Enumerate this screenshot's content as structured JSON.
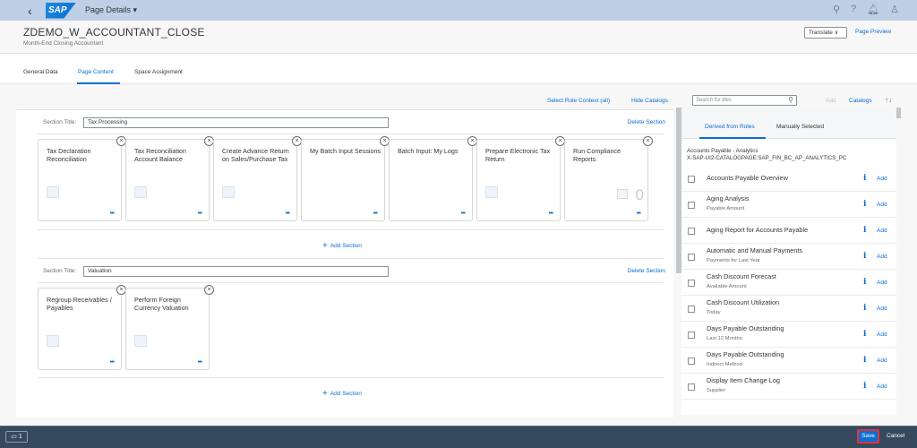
{
  "shell": {
    "app_title": "Page Details ▾",
    "logo": "SAP"
  },
  "header": {
    "title": "ZDEMO_W_ACCOUNTANT_CLOSE",
    "subtitle": "Month-End Closing Accountant",
    "translate": "Translate ∨",
    "preview": "Page Preview"
  },
  "tabs": [
    "General Data",
    "Page Content",
    "Space Assignment"
  ],
  "toolbar": {
    "select_role": "Select Role Context (all)",
    "hide_catalogs": "Hide Catalogs",
    "search_placeholder": "Search for tiles",
    "add": "Add",
    "catalogs": "Catalogs",
    "sort": "↑↓"
  },
  "sections": [
    {
      "label": "Section Title:",
      "title": "Tax Processing",
      "delete": "Delete Section",
      "tiles": [
        {
          "title": "Tax Declaration Reconciliation"
        },
        {
          "title": "Tax Reconciliation Account Balance"
        },
        {
          "title": "Create Advance Return on Sales/Purchase Tax"
        },
        {
          "title": "My Batch Input Sessions"
        },
        {
          "title": "Batch Input: My Logs"
        },
        {
          "title": "Prepare Electronic Tax Return"
        },
        {
          "title": "Run Compliance Reports",
          "number": "0"
        }
      ]
    },
    {
      "label": "Section Title:",
      "title": "Valuation",
      "delete": "Delete Section",
      "tiles": [
        {
          "title": "Regroup Receivables / Payables"
        },
        {
          "title": "Perform Foreign Currency Valuation"
        }
      ]
    }
  ],
  "add_section": "Add Section",
  "right": {
    "tabs": [
      "Derived from Roles",
      "Manually Selected"
    ],
    "catalog_line1": "Accounts Payable - Analytics",
    "catalog_line2": "X-SAP-UI2-CATALOGPAGE:SAP_FIN_BC_AP_ANALYTICS_PC",
    "info": "i",
    "add": "Add",
    "items": [
      {
        "title": "Accounts Payable Overview",
        "sub": ""
      },
      {
        "title": "Aging Analysis",
        "sub": "Payable Amount"
      },
      {
        "title": "Aging Report for Accounts Payable",
        "sub": ""
      },
      {
        "title": "Automatic and Manual Payments",
        "sub": "Payments for Last Year"
      },
      {
        "title": "Cash Discount Forecast",
        "sub": "Available Amount"
      },
      {
        "title": "Cash Discount Utilization",
        "sub": "Today"
      },
      {
        "title": "Days Payable Outstanding",
        "sub": "Last 12 Months"
      },
      {
        "title": "Days Payable Outstanding",
        "sub": "Indirect Method"
      },
      {
        "title": "Display Item Change Log",
        "sub": "Supplier"
      }
    ]
  },
  "footer": {
    "messages": "1",
    "save": "Save",
    "cancel": "Cancel"
  },
  "dots": "•••",
  "close_glyph": "×"
}
